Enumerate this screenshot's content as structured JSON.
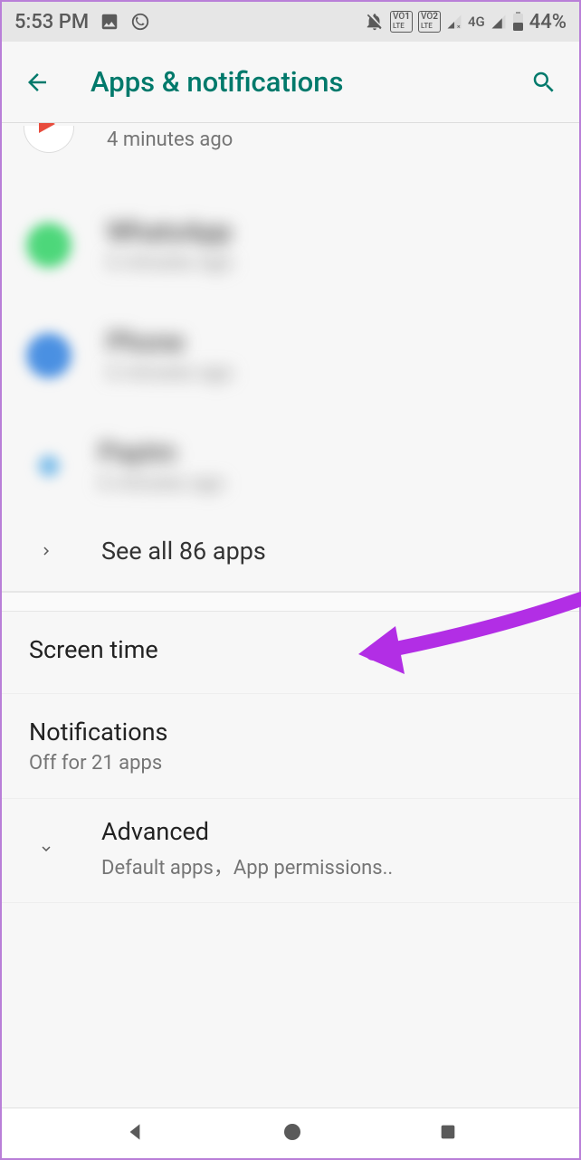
{
  "status": {
    "time": "5:53 PM",
    "battery_pct": "44%",
    "network": "4G"
  },
  "header": {
    "title": "Apps & notifications"
  },
  "recent_apps": {
    "partial": {
      "subtitle": "4 minutes ago"
    },
    "items": [
      {
        "name_blur": "WhatsApp",
        "sub_blur": "6 minutes ago"
      },
      {
        "name_blur": "Phone",
        "sub_blur": "6 minutes ago"
      },
      {
        "name_blur": "Paytm",
        "sub_blur": "6 minutes ago"
      }
    ],
    "see_all": "See all 86 apps",
    "app_count": 86
  },
  "sections": {
    "screen_time": {
      "title": "Screen time"
    },
    "notifications": {
      "title": "Notifications",
      "subtitle": "Off for 21 apps",
      "off_count": 21
    },
    "advanced": {
      "title": "Advanced",
      "subtitle": "Default apps，App permissions.."
    }
  },
  "colors": {
    "accent": "#00796b",
    "annotation": "#b22ee5"
  }
}
